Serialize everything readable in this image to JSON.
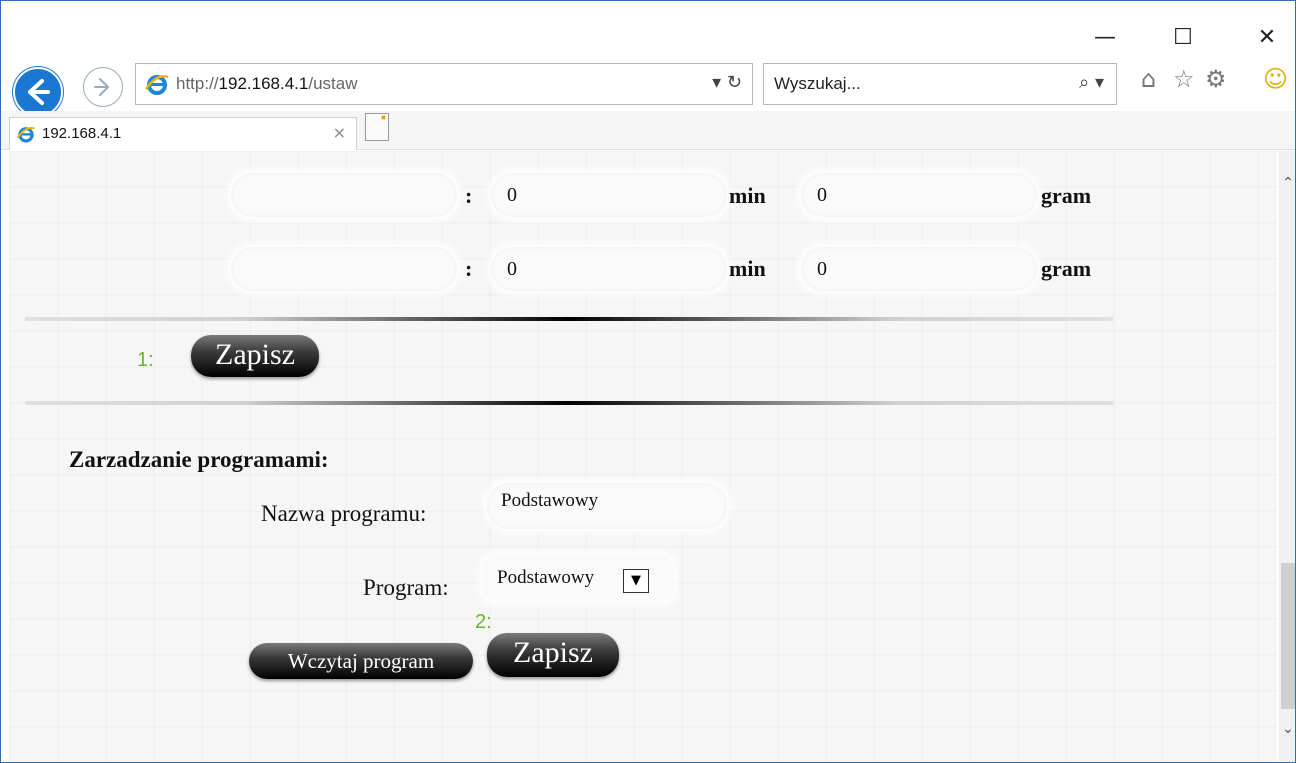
{
  "browser": {
    "window_controls": {
      "minimize": "—",
      "maximize": "☐",
      "close": "✕"
    },
    "address": {
      "url_prefix": "http://",
      "url_host": "192.168.4.1",
      "url_path": "/ustaw",
      "tools": "▾ ↻"
    },
    "search": {
      "placeholder": "Wyszukaj...",
      "icon": "⌕ ▾"
    },
    "toolbar_icons": {
      "home": "⌂",
      "favorites": "☆",
      "settings": "⚙",
      "feedback": "☺"
    },
    "tab": {
      "title": "192.168.4.1",
      "close": "×"
    }
  },
  "page": {
    "feed_rows": [
      {
        "name": "",
        "colon": ":",
        "minutes": "0",
        "min_label": "min",
        "grams": "0",
        "gram_label": "gram"
      },
      {
        "name": "",
        "colon": ":",
        "minutes": "0",
        "min_label": "min",
        "grams": "0",
        "gram_label": "gram"
      }
    ],
    "save1": {
      "number": "1:",
      "label": "Zapisz"
    },
    "program_section": {
      "heading": "Zarzadzanie programami:",
      "name_label": "Nazwa programu:",
      "name_value": "Podstawowy",
      "program_label": "Program:",
      "program_value": "Podstawowy",
      "load_button": "Wczytaj program",
      "save_number": "2:",
      "save_button": "Zapisz"
    }
  },
  "colors": {
    "accent": "#1a78d2",
    "number_green": "#66b82a"
  }
}
